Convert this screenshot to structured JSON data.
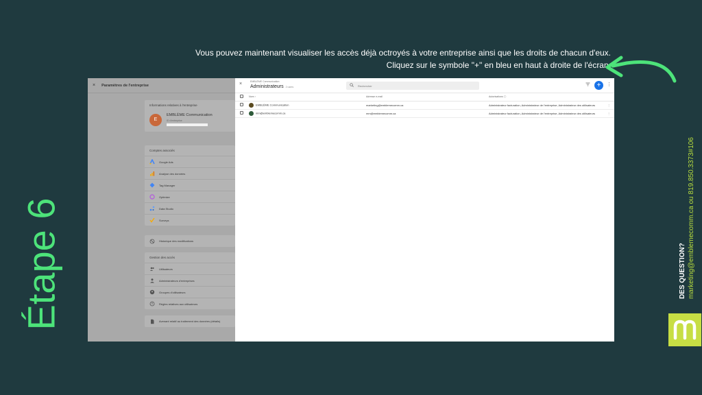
{
  "instruction": {
    "line1": "Vous pouvez maintenant visualiser les accès déjà octroyés à votre entreprise ainsi que les droits de chacun d'eux.",
    "line2": "Cliquez sur le symbole \"+\" en bleu en haut à droite de l'écran."
  },
  "step_label": "Étape 6",
  "contact": {
    "question": "DES QUESTION?",
    "details": "marketing@emblemecomm.ca ou 819.850.3373#106"
  },
  "logo_letter": "m",
  "colors": {
    "background": "#1f3a3f",
    "accent_green": "#4de37a",
    "logo_bg": "#c7de44",
    "add_button": "#1a73e8"
  },
  "left_panel": {
    "close_icon": "×",
    "title": "Paramètres de l'entreprise",
    "info_card": {
      "title": "Informations relatives à l'entreprise",
      "avatar_letter": "E",
      "company_name": "EMBLÈME Communication",
      "company_id_label": "ID d'entreprise"
    },
    "linked_accounts": {
      "title": "Comptes associés",
      "items": [
        {
          "label": "Google Ads",
          "icon": "google-ads-icon"
        },
        {
          "label": "Analyse des données",
          "icon": "analytics-icon"
        },
        {
          "label": "Tag Manager",
          "icon": "tag-manager-icon"
        },
        {
          "label": "Optimize",
          "icon": "optimize-icon"
        },
        {
          "label": "Data Studio",
          "icon": "data-studio-icon"
        },
        {
          "label": "Surveys",
          "icon": "surveys-icon"
        }
      ]
    },
    "history": {
      "label": "Historique des modifications"
    },
    "access": {
      "title": "Gestion des accès",
      "items": [
        {
          "label": "Utilisateurs",
          "icon": "users-icon"
        },
        {
          "label": "Administrateurs d'entreprises",
          "icon": "admins-icon"
        },
        {
          "label": "Groupes d'utilisateurs",
          "icon": "groups-icon"
        },
        {
          "label": "Règles relatives aux utilisateurs",
          "icon": "rules-icon"
        }
      ]
    },
    "data_processing": {
      "label": "Avenant relatif au traitement des données (détails)"
    }
  },
  "main_panel": {
    "breadcrumb": "EMBLÈME Communication",
    "title": "Administrateurs",
    "user_count": "2 users",
    "search_placeholder": "Rechercher",
    "add_label": "+",
    "columns": [
      "Nom ↑",
      "Adresse e-mail",
      "Autorisations ⓘ"
    ],
    "rows": [
      {
        "name": "EMBLÈME Communication",
        "email": "marketing@emblemecomm.ca",
        "permissions": "Administrateur facturation, Administrateur de l'entreprise, Administrateur des utilisateurs"
      },
      {
        "name": "mm@emblemecomm.ca",
        "email": "mm@emblemecomm.ca",
        "permissions": "Administrateur facturation, Administrateur de l'entreprise, Administrateur des utilisateurs"
      }
    ]
  }
}
